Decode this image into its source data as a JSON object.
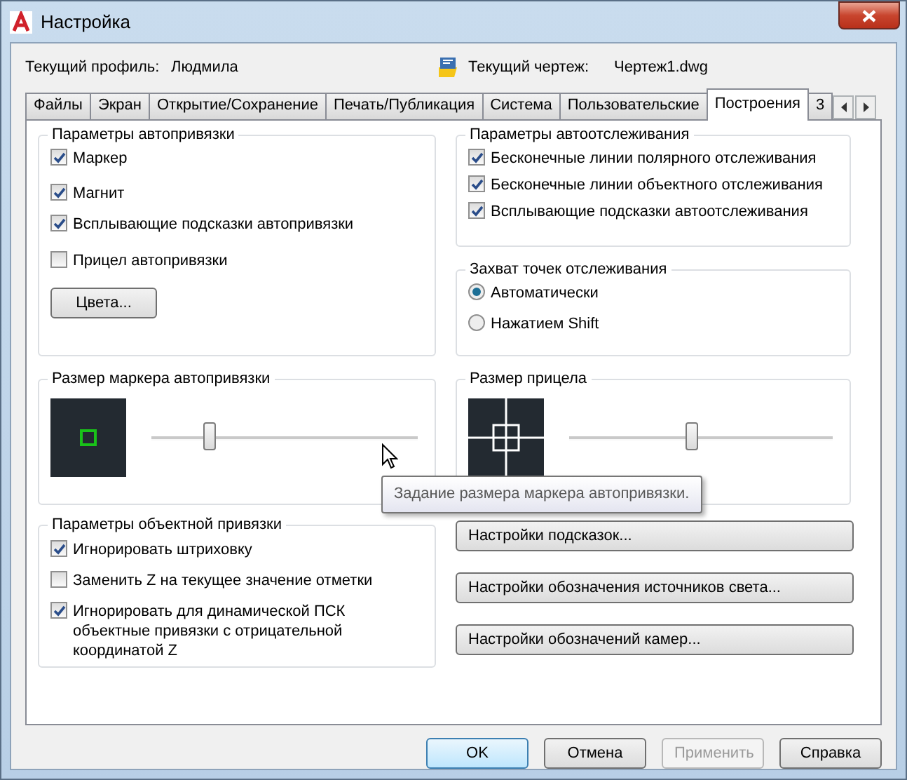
{
  "window": {
    "title": "Настройка"
  },
  "profile": {
    "label": "Текущий профиль:",
    "value": "Людмила"
  },
  "drawing": {
    "label": "Текущий чертеж:",
    "value": "Чертеж1.dwg"
  },
  "tabs": [
    {
      "label": "Файлы",
      "selected": false
    },
    {
      "label": "Экран",
      "selected": false
    },
    {
      "label": "Открытие/Сохранение",
      "selected": false
    },
    {
      "label": "Печать/Публикация",
      "selected": false
    },
    {
      "label": "Система",
      "selected": false
    },
    {
      "label": "Пользовательские",
      "selected": false
    },
    {
      "label": "Построения",
      "selected": true
    },
    {
      "label": "3",
      "selected": false
    }
  ],
  "autosnap": {
    "title": "Параметры автопривязки",
    "options": [
      {
        "label": "Маркер",
        "checked": true
      },
      {
        "label": "Магнит",
        "checked": true
      },
      {
        "label": "Всплывающие подсказки автопривязки",
        "checked": true
      },
      {
        "label": "Прицел автопривязки",
        "checked": false
      }
    ],
    "colors_button": "Цвета..."
  },
  "autotrack": {
    "title": "Параметры автоотслеживания",
    "options": [
      {
        "label": "Бесконечные линии полярного отслеживания",
        "checked": true
      },
      {
        "label": "Бесконечные линии объектного отслеживания",
        "checked": true
      },
      {
        "label": "Всплывающие подсказки автоотслеживания",
        "checked": true
      }
    ]
  },
  "acquisition": {
    "title": "Захват точек отслеживания",
    "options": [
      {
        "label": "Автоматически",
        "selected": true
      },
      {
        "label": "Нажатием Shift",
        "selected": false
      }
    ]
  },
  "marker_size": {
    "title": "Размер маркера автопривязки",
    "level": 0.22
  },
  "aperture_size": {
    "title": "Размер прицела",
    "level": 0.47
  },
  "tooltip": {
    "text": "Задание размера маркера автопривязки."
  },
  "osnap": {
    "title": "Параметры объектной привязки",
    "options": [
      {
        "label": "Игнорировать штриховку",
        "checked": true
      },
      {
        "label": "Заменить Z на текущее значение отметки",
        "checked": false
      },
      {
        "label": "Игнорировать для динамической ПСК объектные привязки с отрицательной координатой Z",
        "checked": true
      }
    ]
  },
  "side_buttons": [
    "Настройки подсказок...",
    "Настройки обозначения источников света...",
    "Настройки обозначений камер..."
  ],
  "footer_buttons": [
    {
      "label": "OK",
      "default": true,
      "disabled": false
    },
    {
      "label": "Отмена",
      "default": false,
      "disabled": false
    },
    {
      "label": "Применить",
      "default": false,
      "disabled": true
    },
    {
      "label": "Справка",
      "default": false,
      "disabled": false
    }
  ]
}
